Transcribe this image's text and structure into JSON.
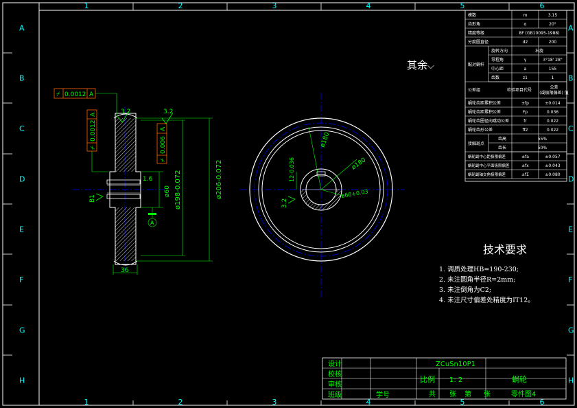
{
  "frame": {
    "columns": [
      "1",
      "2",
      "3",
      "4",
      "5",
      "6"
    ],
    "rows": [
      "A",
      "B",
      "C",
      "D",
      "E",
      "F",
      "G",
      "H"
    ]
  },
  "params_table": {
    "rows": [
      {
        "label": "模数",
        "sym": "m",
        "val": "3.15"
      },
      {
        "label": "齿形角",
        "sym": "α",
        "val": "20°"
      },
      {
        "label": "精度等级",
        "sym": "",
        "val": "8F (GB10095-1988)"
      },
      {
        "label": "分度圆直径",
        "sym": "d2",
        "val": "200"
      }
    ],
    "screw_group": "配对蜗杆",
    "screw_rows": [
      {
        "label": "旋转方向",
        "sym": "",
        "val": "右旋"
      },
      {
        "label": "导程角",
        "sym": "γ",
        "val": "3°18' 28\""
      },
      {
        "label": "中心距",
        "sym": "a",
        "val": "155"
      },
      {
        "label": "齿数",
        "sym": "z1",
        "val": "1"
      }
    ],
    "pair_row": {
      "label": "公差组",
      "mid": "检验项目代号",
      "val": "公差 (或极限偏差) 值"
    },
    "check_rows": [
      {
        "label": "蜗轮齿距累积公差",
        "sym": "±fp",
        "val": "±0.014"
      },
      {
        "label": "蜗轮齿距累积公差",
        "sym": "Fp",
        "val": "0.036"
      },
      {
        "label": "蜗轮齿圈径向跳动公差",
        "sym": "fr",
        "val": "0.022"
      },
      {
        "label": "蜗轮齿形公差",
        "sym": "ff2",
        "val": "0.022"
      }
    ],
    "contact_group": "接触斑点",
    "contact_rows": [
      {
        "label": "齿高",
        "val": "55%"
      },
      {
        "label": "齿长",
        "val": "50%"
      }
    ],
    "tail_rows": [
      {
        "label": "蜗轮副中心距极限偏差",
        "sym": "±fa",
        "val": "±0.057"
      },
      {
        "label": "蜗轮副中心平面极限偏差",
        "sym": "±fx",
        "val": "±0.043"
      },
      {
        "label": "蜗轮副轴交角极限偏差",
        "sym": "±fΣ",
        "val": "±0.080"
      }
    ]
  },
  "notes": {
    "qiyu": "其余",
    "tech_title": "技术要求",
    "tech_items": [
      "1. 调质处理HB=190-230;",
      "2. 未注圆角半径R=2mm;",
      "3. 未注倒角为C2;",
      "4. 未注尺寸偏差处精度为IT12。"
    ]
  },
  "section_view": {
    "tol_top": "0.0012",
    "tol_top_datum": "A",
    "tol_left": "0.0012",
    "tol_left_datum": "A",
    "tol_right": "0.006",
    "tol_right_datum": "A",
    "rough_top_left": "3.2",
    "rough_top_right": "3.2",
    "rough_bore": "1.6",
    "rough_b1": "B1",
    "dia_bore": "ø60",
    "dia_pitch": "ø198-0.072",
    "dia_tip": "ø206-0.072",
    "width": "36",
    "datum_a": "A"
  },
  "front_view": {
    "dia_outer": "ø180",
    "dia_mid": "ø180",
    "keyway": "12-0.036",
    "bore": "ø60+0.03",
    "rough": "3.2"
  },
  "title_block": {
    "material": "ZCuSn10P1",
    "design": "设计",
    "check": "校核",
    "review": "审核",
    "class": "班级",
    "student_no": "学号",
    "scale_label": "比例",
    "scale": "1: 2",
    "part_name": "蜗轮",
    "total": "共",
    "sheets": "张",
    "num": "第",
    "sheet": "张",
    "drawing_no": "零件图4"
  },
  "colors": {
    "background": "#000000",
    "frame": "#ffffff",
    "centerline": "#0000ff",
    "dimension": "#00ff00",
    "text": "#ffffff",
    "tolerance": "#ff6600",
    "hatch": "#ffffff"
  }
}
